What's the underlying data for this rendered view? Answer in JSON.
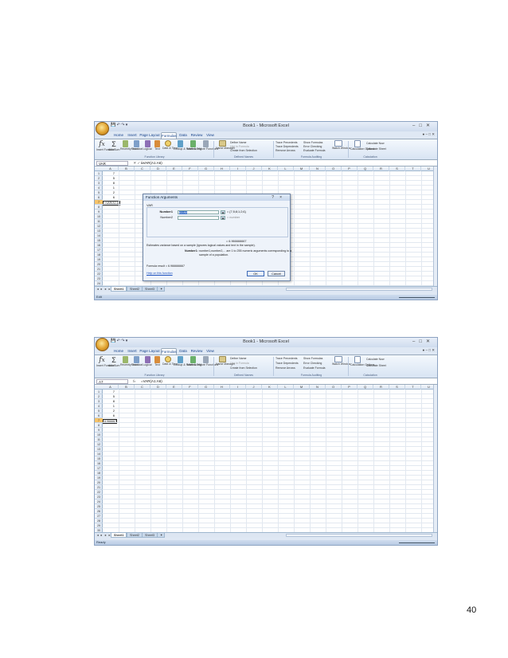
{
  "page": {
    "number": "40"
  },
  "excel": {
    "window_title": "Book1 - Microsoft Excel",
    "tabs": [
      "Home",
      "Insert",
      "Page Layout",
      "Formulas",
      "Data",
      "Review",
      "View"
    ],
    "active_tab": "Formulas",
    "ribbon": {
      "insert_function": "Insert Function",
      "autosum": "AutoSum",
      "recently_used": "Recently Used",
      "financial": "Financial",
      "logical": "Logical",
      "text": "Text",
      "date_time": "Date & Time",
      "lookup_reference": "Lookup & Reference",
      "math_trig": "Math & Trig",
      "more_functions": "More Functions",
      "function_library": "Function Library",
      "name_manager": "Name Manager",
      "define_name": "Define Name",
      "use_in_formula": "Use in Formula",
      "create_from_selection": "Create from Selection",
      "defined_names": "Defined Names",
      "trace_precedents": "Trace Precedents",
      "trace_dependents": "Trace Dependents",
      "remove_arrows": "Remove Arrows",
      "show_formulas": "Show Formulas",
      "error_checking": "Error Checking",
      "evaluate_formula": "Evaluate Formula",
      "watch_window": "Watch Window",
      "formula_auditing": "Formula Auditing",
      "calculation_options": "Calculation Options",
      "calculate_now": "Calculate Now",
      "calculate_sheet": "Calculate Sheet",
      "calculation": "Calculation"
    },
    "columns": [
      "A",
      "B",
      "C",
      "D",
      "E",
      "F",
      "G",
      "H",
      "I",
      "J",
      "K",
      "L",
      "M",
      "N",
      "O",
      "P",
      "Q",
      "R",
      "S",
      "T",
      "U"
    ],
    "column_a_values": [
      "7",
      "5",
      "8",
      "1",
      "2",
      "6"
    ],
    "sheet_tabs": [
      "Sheet1",
      "Sheet2",
      "Sheet3"
    ],
    "status": "Ready"
  },
  "screenshot1": {
    "name_box": "VAR",
    "formula": "=VAR(A1:A6)",
    "active_cell_text": "=VAR(A1:A6)",
    "status": "Edit",
    "dialog": {
      "title": "Function Arguments",
      "function_name": "VAR",
      "number1_label": "Number1",
      "number1_value": "A1:A6",
      "number1_result": "= {7;5;8;1;2;6}",
      "number2_label": "Number2",
      "number2_result": "= number",
      "total_result": "= 6.966666667",
      "description": "Estimates variance based on a sample (ignores logical values and text in the sample).",
      "arg_help_label": "Number1:",
      "arg_help_line1": "number1,number2,... are 1 to 255 numeric arguments corresponding to a",
      "arg_help_line2": "sample of a population.",
      "formula_result": "Formula result = 6.966666667",
      "help_link": "Help on this function",
      "ok": "OK",
      "cancel": "Cancel",
      "help_btn": "?",
      "close_btn": "×"
    }
  },
  "screenshot2": {
    "name_box": "A7",
    "formula": "=VAR(A1:A6)",
    "active_cell_text": "6.966667"
  }
}
